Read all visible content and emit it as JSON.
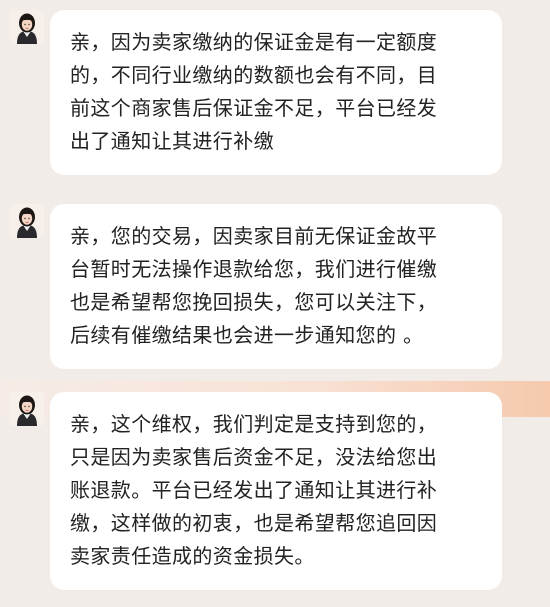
{
  "chat": {
    "messages": [
      {
        "sender": "agent",
        "avatar_icon": "female-agent-avatar-icon",
        "lines": [
          "亲，因为卖家缴纳的保证金是有一定额度",
          "的，不同行业缴纳的数额也会有不同，目",
          "前这个商家售后保证金不足，平台已经发",
          "出了通知让其进行补缴"
        ]
      },
      {
        "sender": "agent",
        "avatar_icon": "female-agent-avatar-icon",
        "lines": [
          "亲，您的交易，因卖家目前无保证金故平",
          "台暂时无法操作退款给您，我们进行催缴",
          "也是希望帮您挽回损失，您可以关注下，",
          "后续有催缴结果也会进一步通知您的 。"
        ]
      },
      {
        "sender": "agent",
        "avatar_icon": "female-agent-avatar-icon",
        "lines": [
          "亲，这个维权，我们判定是支持到您的，",
          "只是因为卖家售后资金不足，没法给您出",
          "账退款。平台已经发出了通知让其进行补",
          "缴，这样做的初衷，也是希望帮您追回因",
          "卖家责任造成的资金损失。"
        ]
      }
    ]
  },
  "colors": {
    "background": "#f2ece8",
    "bubble": "#ffffff",
    "text": "#222222",
    "highlight_band": "#f6c9ad"
  }
}
